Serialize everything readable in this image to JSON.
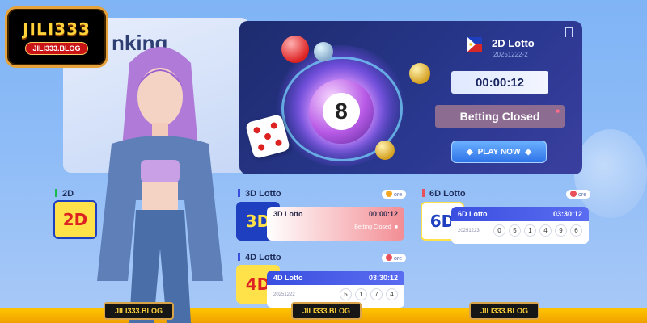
{
  "brand": {
    "name": "JILI333",
    "url": "JILI333.BLOG"
  },
  "ranking": {
    "title": "nking"
  },
  "banner": {
    "game": "2D Lotto",
    "draw_code": "20251222-2",
    "timer": "00:00:12",
    "status": "Betting Closed",
    "play_label": "PLAY NOW",
    "ball_number": "8"
  },
  "cards": [
    {
      "section": "2D",
      "logo": "2D",
      "title": "",
      "time": "",
      "status": "",
      "date": "",
      "numbers": []
    },
    {
      "section": "3D Lotto",
      "logo": "3D",
      "more": "ore",
      "title": "3D Lotto",
      "time": "00:00:12",
      "status": "Betting Closed",
      "date": "",
      "numbers": []
    },
    {
      "section": "6D Lotto",
      "logo": "6D",
      "more": "ore",
      "title": "6D Lotto",
      "time": "03:30:12",
      "date": "20251223",
      "numbers": [
        "0",
        "5",
        "1",
        "4",
        "9",
        "6"
      ]
    },
    {
      "section": "4D Lotto",
      "logo": "4D",
      "more": "ore",
      "title": "4D Lotto",
      "time": "03:30:12",
      "date": "20251222",
      "numbers": [
        "5",
        "1",
        "7",
        "4"
      ]
    }
  ],
  "footer_tags": [
    "JILI333.BLOG",
    "JILI333.BLOG",
    "JILI333.BLOG"
  ],
  "colors": {
    "accent": "#ffc400",
    "banner_bg": "#1d2b6e",
    "red_card": "#e8505c",
    "blue_card": "#3a4fe0"
  }
}
